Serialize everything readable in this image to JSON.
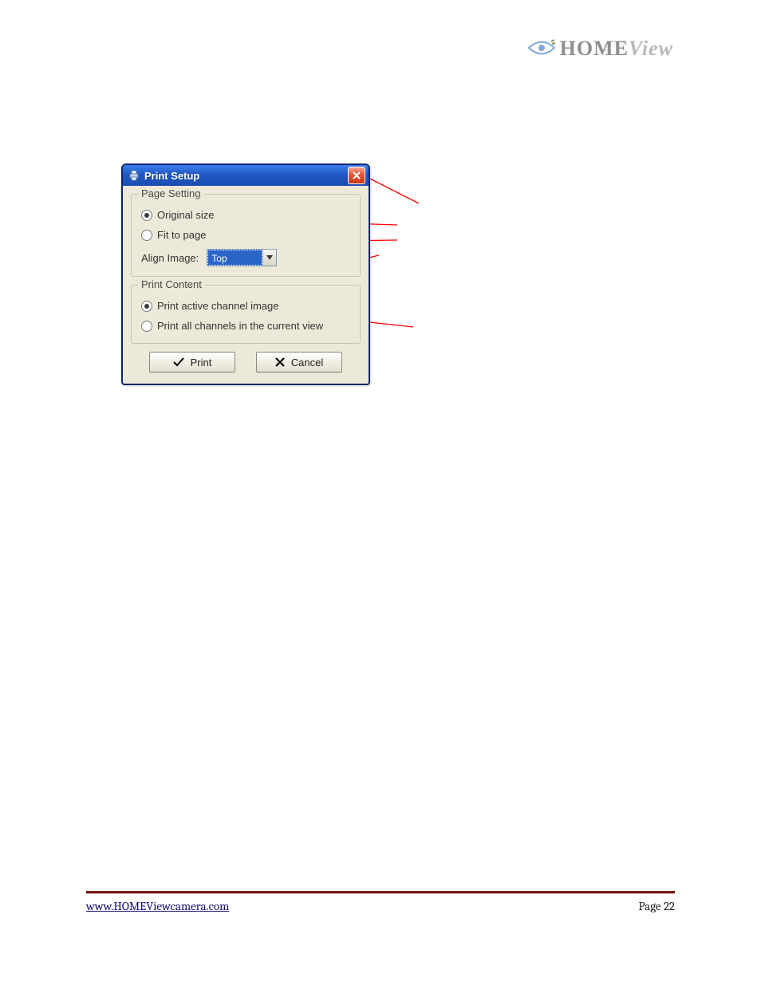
{
  "header": {
    "brand_main": "HOME",
    "brand_suffix": "View"
  },
  "dialog": {
    "title": "Print Setup",
    "page_setting": {
      "legend": "Page Setting",
      "original_size_label": "Original size",
      "fit_to_page_label": "Fit to page",
      "align_label": "Align Image:",
      "align_value": "Top"
    },
    "print_content": {
      "legend": "Print Content",
      "active_channel_label": "Print active channel image",
      "all_channels_label": "Print all channels in the current view"
    },
    "buttons": {
      "print_label": "Print",
      "cancel_label": "Cancel"
    }
  },
  "footer": {
    "url": "www.HOMEViewcamera.com",
    "page_label": "Page 22"
  }
}
